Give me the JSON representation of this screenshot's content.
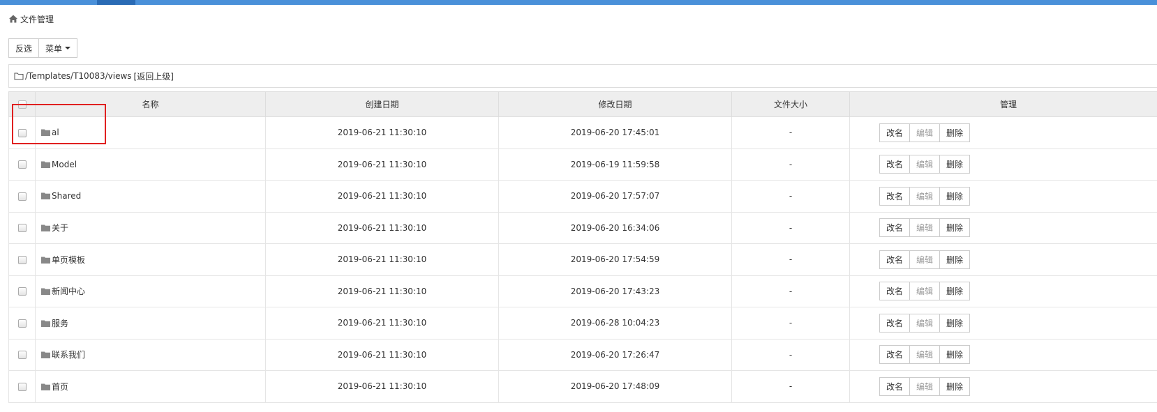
{
  "breadcrumb": {
    "title": "文件管理"
  },
  "toolbar": {
    "invert_label": "反选",
    "menu_label": "菜单"
  },
  "path": {
    "current": "/Templates/T10083/views",
    "up_label": "[返回上级]"
  },
  "table": {
    "headers": {
      "name": "名称",
      "created": "创建日期",
      "modified": "修改日期",
      "size": "文件大小",
      "manage": "管理"
    },
    "actions": {
      "rename": "改名",
      "edit": "编辑",
      "delete": "删除"
    },
    "rows": [
      {
        "name": "al",
        "created": "2019-06-21 11:30:10",
        "modified": "2019-06-20 17:45:01",
        "size": "-"
      },
      {
        "name": "Model",
        "created": "2019-06-21 11:30:10",
        "modified": "2019-06-19 11:59:58",
        "size": "-"
      },
      {
        "name": "Shared",
        "created": "2019-06-21 11:30:10",
        "modified": "2019-06-20 17:57:07",
        "size": "-"
      },
      {
        "name": "关于",
        "created": "2019-06-21 11:30:10",
        "modified": "2019-06-20 16:34:06",
        "size": "-"
      },
      {
        "name": "单页模板",
        "created": "2019-06-21 11:30:10",
        "modified": "2019-06-20 17:54:59",
        "size": "-"
      },
      {
        "name": "新闻中心",
        "created": "2019-06-21 11:30:10",
        "modified": "2019-06-20 17:43:23",
        "size": "-"
      },
      {
        "name": "服务",
        "created": "2019-06-21 11:30:10",
        "modified": "2019-06-28 10:04:23",
        "size": "-"
      },
      {
        "name": "联系我们",
        "created": "2019-06-21 11:30:10",
        "modified": "2019-06-20 17:26:47",
        "size": "-"
      },
      {
        "name": "首页",
        "created": "2019-06-21 11:30:10",
        "modified": "2019-06-20 17:48:09",
        "size": "-"
      }
    ]
  },
  "colors": {
    "accent": "#4a90d9",
    "highlight": "#e02020"
  }
}
